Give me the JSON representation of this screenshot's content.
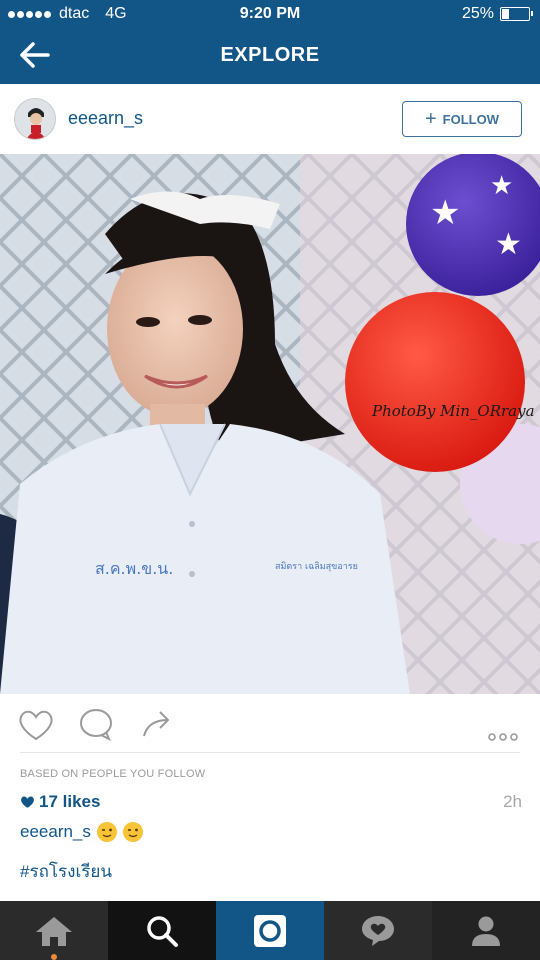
{
  "status_bar": {
    "carrier": "dtac",
    "network": "4G",
    "time": "9:20 PM",
    "battery": "25%",
    "battery_level": 0.25
  },
  "nav": {
    "title": "EXPLORE",
    "back_icon": "back-arrow-icon"
  },
  "post": {
    "username": "eeearn_s",
    "follow_label": "FOLLOW",
    "photo_watermark": "PhotoBy Min_ORraya",
    "based_on": "BASED ON PEOPLE YOU FOLLOW",
    "likes": "17 likes",
    "time_ago": "2h",
    "caption_user": "eeearn_s",
    "hashtag": "#รถโรงเรียน"
  },
  "colors": {
    "header_bg": "#125688",
    "link": "#125688",
    "tab_active": "#125688",
    "tab_bar": "#1b1b1b"
  },
  "tabbar": {
    "tabs": [
      "home-icon",
      "search-icon",
      "camera-icon",
      "activity-icon",
      "profile-icon"
    ]
  }
}
